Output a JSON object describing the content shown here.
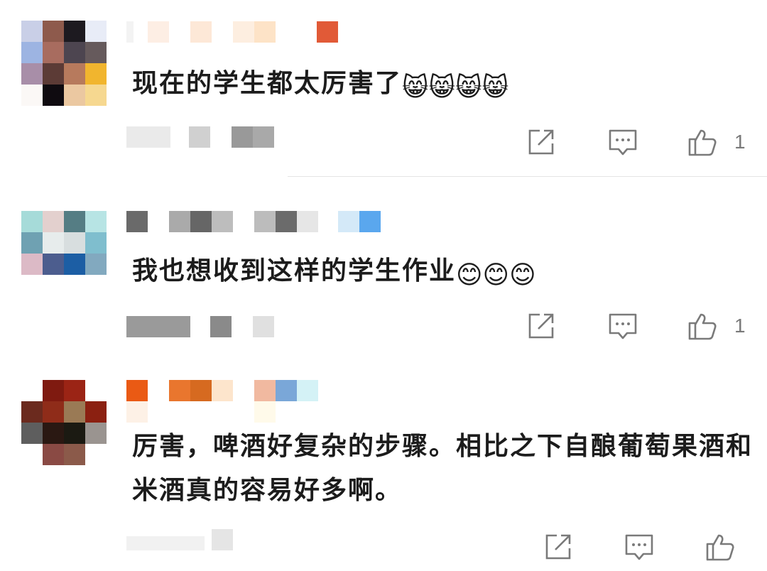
{
  "comments": [
    {
      "text": "现在的学生都太厉害了",
      "emojis": [
        "😸",
        "😸",
        "😸",
        "😸"
      ],
      "emoji_icon": "cat-face-icon",
      "like_count": "1",
      "avatar_colors": [
        [
          "#c9cfe7",
          "#8e5a4c",
          "#1d1a20",
          "#e8ecf7"
        ],
        [
          "#9db4e2",
          "#a86c5f",
          "#4d4550",
          "#665a5c"
        ],
        [
          "#a88ea8",
          "#5c3b36",
          "#b77a5d",
          "#f1b52e"
        ],
        [
          "#fbf8f6",
          "#0f0b10",
          "#ebc8a1",
          "#f6d890"
        ]
      ],
      "name_colors": [
        "#fdeee4",
        "#fde8d7",
        "#fdeee0",
        "#fde3c7",
        "#e15a37"
      ],
      "meta_colors": [
        "#eaeaea",
        "#d0d0d0",
        "#999999",
        "#a9a9a9"
      ]
    },
    {
      "text": "我也想收到这样的学生作业",
      "emojis": [
        "😊",
        "😊",
        "😊"
      ],
      "emoji_icon": "blush-face-icon",
      "like_count": "1",
      "avatar_colors": [
        [
          "#a6dbd9",
          "#e3d0ce",
          "#557d84",
          "#b7e4e4"
        ],
        [
          "#6fa1b2",
          "#e7ecec",
          "#d8dedf",
          "#7fbece"
        ],
        [
          "#dcbac6",
          "#4c5d8e",
          "#1c5ea4",
          "#82a9bf"
        ]
      ],
      "name_colors": [
        "#6a6a6a",
        "#aaaaaa",
        "#666666",
        "#bdbdbd",
        "#bcbcbc",
        "#6b6b6b",
        "#e6e6e6",
        "#d4e9f8",
        "#5aa7ee"
      ],
      "meta_colors": [
        "#9a9a9a",
        "#8a8a8a",
        "#e0e0e0"
      ]
    },
    {
      "text": "厉害，啤酒好复杂的步骤。相比之下自酿葡萄果酒和米酒真的容易好多啊。",
      "emojis": [],
      "emoji_icon": "",
      "like_count": "",
      "avatar_colors": [
        [
          "#ffffff",
          "#7f1a10",
          "#9b2415",
          "#ffffff"
        ],
        [
          "#6b2a1e",
          "#8f2c19",
          "#9a7a55",
          "#8b2011"
        ],
        [
          "#5e5e5e",
          "#2a1812",
          "#1b1a12",
          "#9a9490"
        ],
        [
          "#ffffff",
          "#8a4a44",
          "#8b5a4a",
          "#ffffff"
        ]
      ],
      "name_colors": [
        "#ea5a14",
        "#e9762e",
        "#d66a20",
        "#fde5cc",
        "#f1b9a0",
        "#7aa7d8",
        "#d4f2f6"
      ],
      "meta_colors": [
        "#f1f1f1",
        "#e5e5e5",
        "#d8d8d8"
      ]
    }
  ],
  "icons": {
    "share": "share-icon",
    "reply": "comment-icon",
    "like": "thumbs-up-icon"
  }
}
